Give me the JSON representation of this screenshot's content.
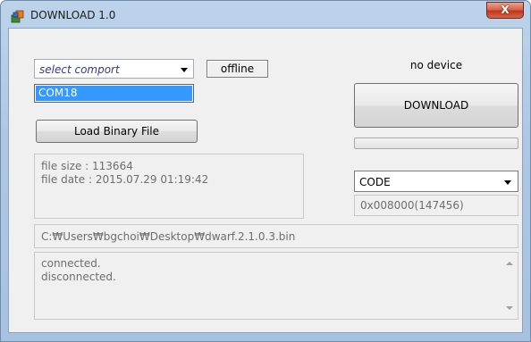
{
  "window": {
    "title": "DOWNLOAD 1.0",
    "close_label": "X"
  },
  "comport": {
    "placeholder": "select comport",
    "options": [
      "COM18"
    ],
    "status_label": "offline"
  },
  "device": {
    "status": "no device"
  },
  "download_button_label": "DOWNLOAD",
  "download_progress": 0,
  "load_button_label": "Load Binary File",
  "file_info": {
    "size_line": "file size : 113664",
    "date_line": "file date : 2015.07.29 01:19:42"
  },
  "memory": {
    "selected": "CODE",
    "address": "0x008000(147456)"
  },
  "file_path": "C:₩Users₩bgchoi₩Desktop₩dwarf.2.1.0.3.bin",
  "log_lines": [
    "connected.",
    "disconnected."
  ]
}
